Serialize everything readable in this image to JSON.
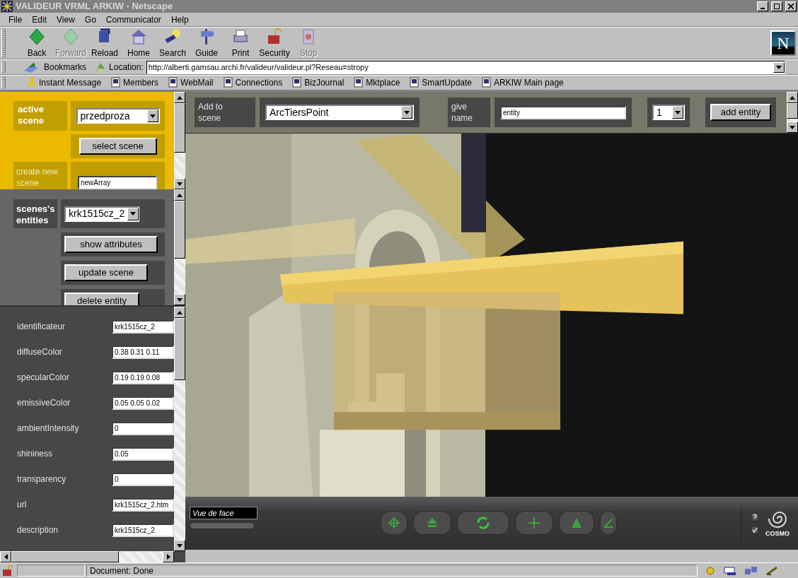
{
  "window": {
    "title": "VALIDEUR VRML ARKIW - Netscape"
  },
  "menu": [
    "File",
    "Edit",
    "View",
    "Go",
    "Communicator",
    "Help"
  ],
  "toolbar": [
    {
      "label": "Back",
      "kind": "back",
      "disabled": false
    },
    {
      "label": "Forward",
      "kind": "forward",
      "disabled": true
    },
    {
      "label": "Reload",
      "kind": "reload",
      "disabled": false
    },
    {
      "label": "Home",
      "kind": "home",
      "disabled": false
    },
    {
      "label": "Search",
      "kind": "search",
      "disabled": false
    },
    {
      "label": "Guide",
      "kind": "guide",
      "disabled": false
    },
    {
      "label": "Print",
      "kind": "print",
      "disabled": false
    },
    {
      "label": "Security",
      "kind": "security",
      "disabled": false
    },
    {
      "label": "Stop",
      "kind": "stop",
      "disabled": true
    }
  ],
  "throbber": {
    "letter": "N"
  },
  "location_bar": {
    "bookmarks": "Bookmarks",
    "label": "Location:",
    "url": "http://alberti.gamsau.archi.fr/valideur/valideur.pl?Reseau=stropy"
  },
  "personal_toolbar": [
    {
      "label": "Instant Message",
      "kind": "person"
    },
    {
      "label": "Members",
      "kind": "page"
    },
    {
      "label": "WebMail",
      "kind": "page"
    },
    {
      "label": "Connections",
      "kind": "page"
    },
    {
      "label": "BizJournal",
      "kind": "page"
    },
    {
      "label": "Mktplace",
      "kind": "page"
    },
    {
      "label": "SmartUpdate",
      "kind": "page"
    },
    {
      "label": "ARKIW Main page",
      "kind": "page"
    }
  ],
  "scene_frame": {
    "active_label": "active scene",
    "active_value": "przedproza",
    "select_button": "select scene",
    "create_label": "create new scene",
    "create_value": "newArray"
  },
  "entities_frame": {
    "label": "scenes's entities",
    "value": "krk1515cz_2",
    "buttons": [
      "show attributes",
      "update scene",
      "delete entity"
    ]
  },
  "attributes": [
    {
      "label": "identificateur",
      "value": "krk1515cz_2"
    },
    {
      "label": "diffuseColor",
      "value": "0.38 0.31 0.11"
    },
    {
      "label": "specularColor",
      "value": "0.19 0.19 0.08"
    },
    {
      "label": "emissiveColor",
      "value": "0.05 0.05 0.02"
    },
    {
      "label": "ambientIntensity",
      "value": "0"
    },
    {
      "label": "shininess",
      "value": "0.05"
    },
    {
      "label": "transparency",
      "value": "0"
    },
    {
      "label": "url",
      "value": "krk1515cz_2.htm"
    },
    {
      "label": "description",
      "value": "krk1515cz_2"
    }
  ],
  "add_bar": {
    "add_label": "Add to scene",
    "type_value": "ArcTiersPoint",
    "name_label": "give name",
    "name_value": "entity",
    "count_value": "1",
    "add_button": "add entity"
  },
  "viewer": {
    "kind": "picture",
    "viewpoint": "Vue de face",
    "brand": "COSMO"
  },
  "status_bar": {
    "text": "Document: Done"
  }
}
